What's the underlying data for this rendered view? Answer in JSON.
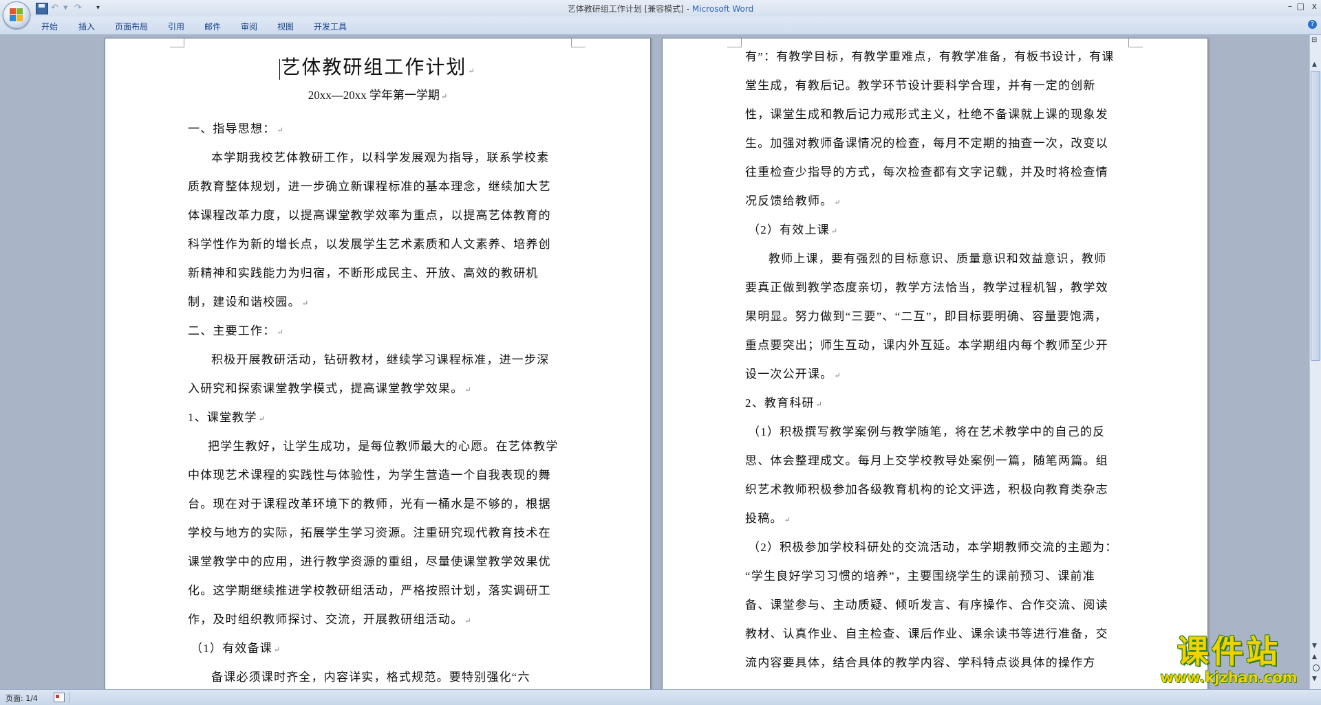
{
  "titlebar": {
    "doc_name": "艺体教研组工作计划 [兼容模式] - ",
    "app_name": "Microsoft Word",
    "undo": "↶",
    "redo": "↷",
    "customize": "▾",
    "minimize": "–",
    "maximize": "□",
    "close": "x"
  },
  "ribbon": {
    "tabs": [
      "开始",
      "插入",
      "页面布局",
      "引用",
      "邮件",
      "审阅",
      "视图",
      "开发工具"
    ],
    "help": "?"
  },
  "page1": {
    "title": "艺体教研组工作计划",
    "subtitle": "20xx—20xx 学年第一学期",
    "lines": [
      "一、指导思想：",
      "本学期我校艺体教研工作，以科学发展观为指导，联系学校素",
      "质教育整体规划，进一步确立新课程标准的基本理念，继续加大艺",
      "体课程改革力度，以提高课堂教学效率为重点，以提高艺体教育的",
      "科学性作为新的增长点，以发展学生艺术素质和人文素养、培养创",
      "新精神和实践能力为归宿，不断形成民主、开放、高效的教研机",
      "制，建设和谐校园。",
      "二、主要工作：",
      "积极开展教研活动，钻研教材，继续学习课程标准，进一步深",
      "入研究和探索课堂教学模式，提高课堂教学效果。",
      "1、课堂教学",
      "把学生教好，让学生成功，是每位教师最大的心愿。在艺体教学",
      "中体现艺术课程的实践性与体验性，为学生营造一个自我表现的舞",
      "台。现在对于课程改革环境下的教师，光有一桶水是不够的，根据",
      "学校与地方的实际，拓展学生学习资源。注重研究现代教育技术在",
      "课堂教学中的应用，进行教学资源的重组，尽量使课堂教学效果优",
      "化。这学期继续推进学校教研组活动，严格按照计划，落实调研工",
      "作，及时组织教师探讨、交流，开展教研组活动。",
      "（1）有效备课",
      "备课必须课时齐全，内容详实，格式规范。要特别强化“六"
    ]
  },
  "page2": {
    "lines": [
      "有”：有教学目标，有教学重难点，有教学准备，有板书设计，有课",
      "堂生成，有教后记。教学环节设计要科学合理，并有一定的创新",
      "性，课堂生成和教后记力戒形式主义，杜绝不备课就上课的现象发",
      "生。加强对教师备课情况的检查，每月不定期的抽查一次，改变以",
      "往重检查少指导的方式，每次检查都有文字记载，并及时将检查情",
      "况反馈给教师。",
      "（2）有效上课",
      "教师上课，要有强烈的目标意识、质量意识和效益意识，教师",
      "要真正做到教学态度亲切，教学方法恰当，教学过程机智，教学效",
      "果明显。努力做到“三要”、“二互”，即目标要明确、容量要饱满，",
      "重点要突出；师生互动，课内外互延。本学期组内每个教师至少开",
      "设一次公开课。",
      "2、教育科研",
      "（1）积极撰写教学案例与教学随笔，将在艺术教学中的自己的反",
      "思、体会整理成文。每月上交学校教导处案例一篇，随笔两篇。组",
      "织艺术教师积极参加各级教育机构的论文评选，积极向教育类杂志",
      "投稿。",
      "（2）积极参加学校科研处的交流活动，本学期教师交流的主题为：",
      "“学生良好学习习惯的培养”，主要围绕学生的课前预习、课前准",
      "备、课堂参与、主动质疑、倾听发言、有序操作、合作交流、阅读",
      "教材、认真作业、自主检查、课后作业、课余读书等进行准备，交",
      "流内容要具体，结合具体的教学内容、学科特点谈具体的操作方"
    ]
  },
  "paragraph_mark": "↵",
  "statusbar": {
    "page_info": "页面: 1/4"
  },
  "watermark": {
    "name": "课件站",
    "url": "www.kjzhan.com"
  },
  "colors": {
    "app_name": "#2a63b6",
    "workspace": "#a9b5c6",
    "watermark": "#f0d200"
  }
}
